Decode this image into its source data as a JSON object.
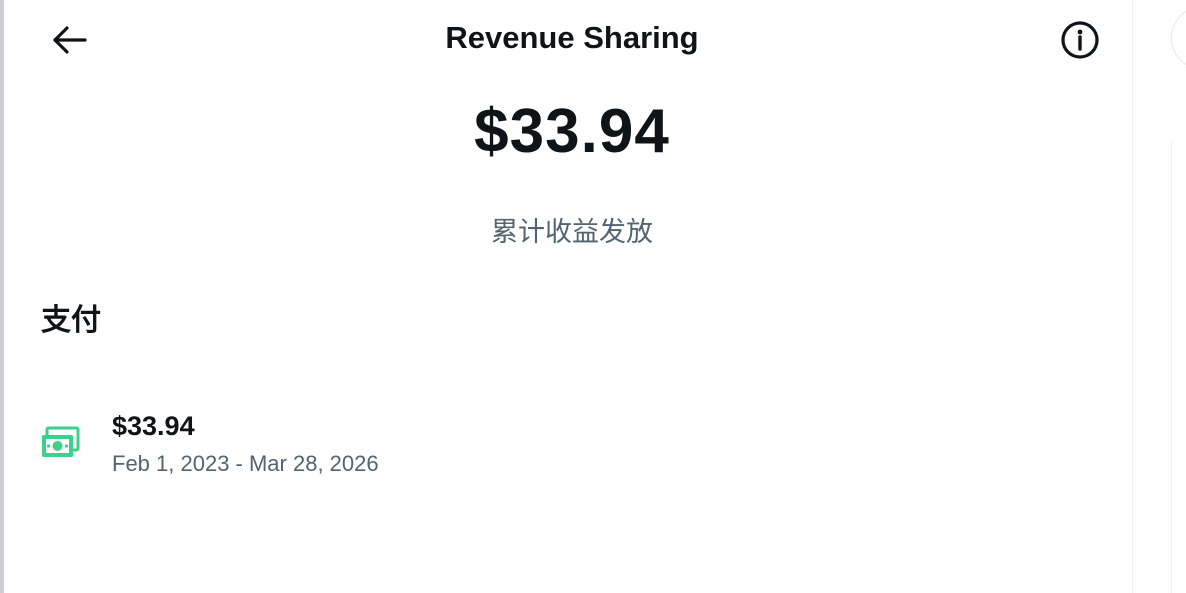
{
  "header": {
    "back_icon": "arrow-left-icon",
    "title": "Revenue Sharing",
    "info_icon": "info-circle-icon"
  },
  "summary": {
    "total_amount": "$33.94",
    "label": "累计收益发放"
  },
  "payments": {
    "section_title": "支付",
    "items": [
      {
        "icon": "money-icon",
        "amount": "$33.94",
        "date_range": "Feb 1, 2023 - Mar 28, 2026"
      }
    ]
  },
  "colors": {
    "text_primary": "#0f1419",
    "text_secondary": "#536471",
    "money_icon": "#3bd18a"
  }
}
